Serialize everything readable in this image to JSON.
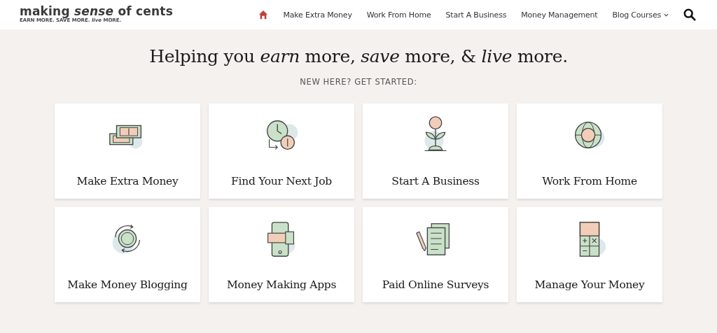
{
  "logo": {
    "title": "making *sense* of cents",
    "tagline": "EARN MORE. SAVE MORE. *live* MORE."
  },
  "nav": {
    "home_selected": true,
    "items": [
      {
        "label": "Make Extra Money",
        "kind": "link"
      },
      {
        "label": "Work From Home",
        "kind": "link"
      },
      {
        "label": "Start A Business",
        "kind": "link"
      },
      {
        "label": "Money Management",
        "kind": "link"
      },
      {
        "label": "Blog Courses",
        "kind": "dropdown"
      }
    ]
  },
  "hero": {
    "headline": "Helping you *earn* more, *save* more, & *live* more.",
    "subtitle": "NEW HERE? GET STARTED:"
  },
  "cards": [
    {
      "label": "Make Extra Money",
      "kind": "cash"
    },
    {
      "label": "Find Your Next Job",
      "kind": "clock"
    },
    {
      "label": "Start A Business",
      "kind": "plant"
    },
    {
      "label": "Work From Home",
      "kind": "globe"
    },
    {
      "label": "Make Money Blogging",
      "kind": "cycle"
    },
    {
      "label": "Money Making Apps",
      "kind": "phone"
    },
    {
      "label": "Paid Online Surveys",
      "kind": "document"
    },
    {
      "label": "Manage Your Money",
      "kind": "calculator"
    }
  ]
}
